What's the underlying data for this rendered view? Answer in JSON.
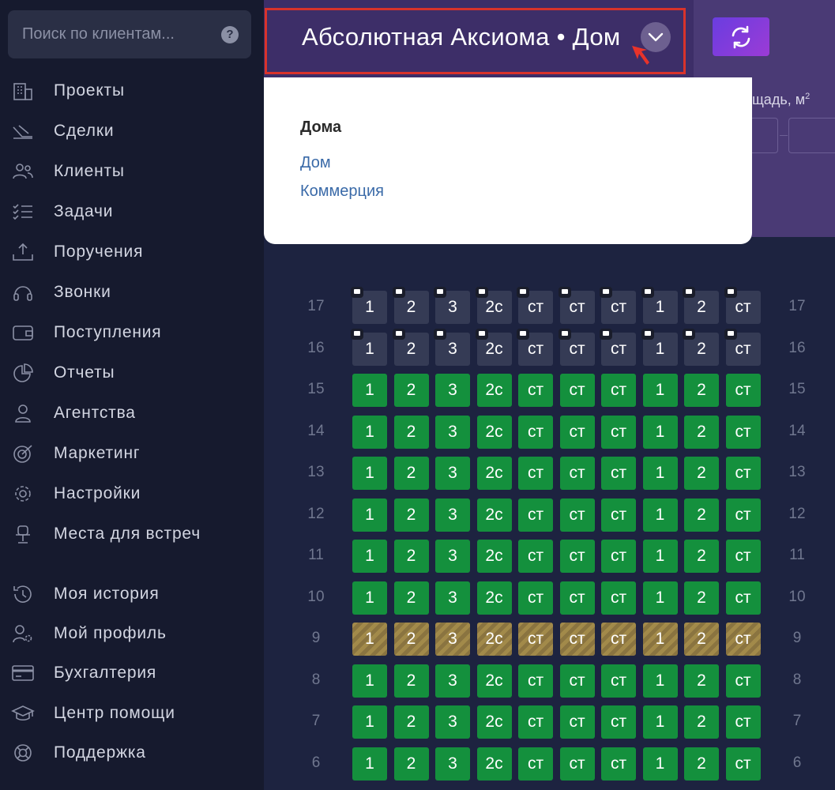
{
  "sidebar": {
    "search": {
      "placeholder": "Поиск по клиентам..."
    },
    "items": [
      {
        "label": "Проекты",
        "icon": "building-icon"
      },
      {
        "label": "Сделки",
        "icon": "handshake-icon"
      },
      {
        "label": "Клиенты",
        "icon": "users-icon"
      },
      {
        "label": "Задачи",
        "icon": "checklist-icon"
      },
      {
        "label": "Поручения",
        "icon": "inbox-upload-icon"
      },
      {
        "label": "Звонки",
        "icon": "headset-icon"
      },
      {
        "label": "Поступления",
        "icon": "wallet-icon"
      },
      {
        "label": "Отчеты",
        "icon": "pie-chart-icon"
      },
      {
        "label": "Агентства",
        "icon": "agent-icon"
      },
      {
        "label": "Маркетинг",
        "icon": "target-icon"
      },
      {
        "label": "Настройки",
        "icon": "gear-icon"
      },
      {
        "label": "Места для встреч",
        "icon": "chair-icon"
      }
    ],
    "bottom_items": [
      {
        "label": "Моя история",
        "icon": "history-icon"
      },
      {
        "label": "Мой профиль",
        "icon": "user-gear-icon"
      },
      {
        "label": "Бухгалтерия",
        "icon": "card-icon"
      },
      {
        "label": "Центр помощи",
        "icon": "graduation-cap-icon"
      },
      {
        "label": "Поддержка",
        "icon": "lifebuoy-icon"
      }
    ]
  },
  "header": {
    "project_title": "Абсолютная Аксиома • Дом",
    "area_label": "щадь, м",
    "area_unit_sup": "2"
  },
  "dropdown": {
    "group_title": "Дома",
    "options": [
      "Дом",
      "Коммерция"
    ]
  },
  "grid": {
    "unit_labels": [
      "1",
      "2",
      "3",
      "2с",
      "ст",
      "ст",
      "ст",
      "1",
      "2",
      "ст"
    ],
    "floors": [
      {
        "floor": "17",
        "status": "gray",
        "comments": true
      },
      {
        "floor": "16",
        "status": "gray",
        "comments": true
      },
      {
        "floor": "15",
        "status": "green",
        "comments": false
      },
      {
        "floor": "14",
        "status": "green",
        "comments": false
      },
      {
        "floor": "13",
        "status": "green",
        "comments": false
      },
      {
        "floor": "12",
        "status": "green",
        "comments": false
      },
      {
        "floor": "11",
        "status": "green",
        "comments": false
      },
      {
        "floor": "10",
        "status": "green",
        "comments": false
      },
      {
        "floor": "9",
        "status": "hatch",
        "comments": false
      },
      {
        "floor": "8",
        "status": "green",
        "comments": false
      },
      {
        "floor": "7",
        "status": "green",
        "comments": false
      },
      {
        "floor": "6",
        "status": "green",
        "comments": false
      }
    ]
  },
  "colors": {
    "sidebar_bg": "#161a2e",
    "header_bg": "#3d2e68",
    "available": "#14903d",
    "selector_outline": "#d9332b"
  }
}
